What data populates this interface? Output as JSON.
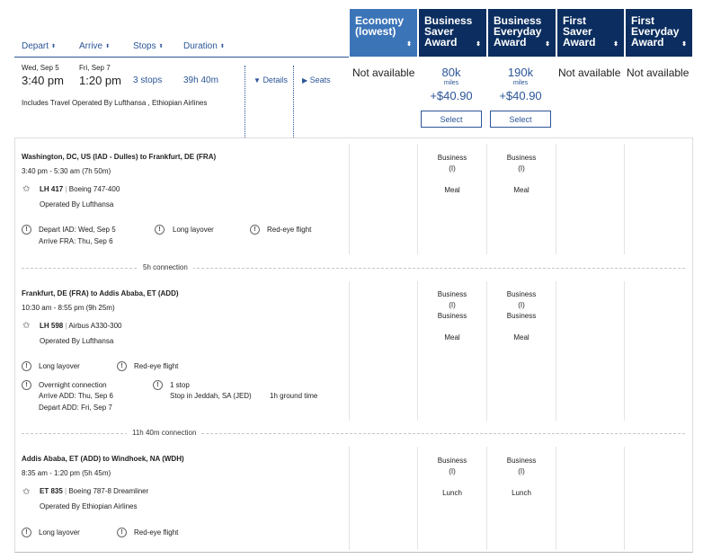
{
  "sort": {
    "depart": "Depart",
    "arrive": "Arrive",
    "stops": "Stops",
    "duration": "Duration",
    "arrow": "⬍"
  },
  "fares": [
    {
      "title": "Economy",
      "sub": "(lowest)"
    },
    {
      "title": "Business Saver Award"
    },
    {
      "title": "Business Everyday Award"
    },
    {
      "title": "First Saver Award"
    },
    {
      "title": "First Everyday Award"
    }
  ],
  "summary": {
    "depart_date": "Wed, Sep 5",
    "depart_time": "3:40 pm",
    "arrive_date": "Fri, Sep 7",
    "arrive_time": "1:20 pm",
    "stops": "3 stops",
    "duration": "39h 40m",
    "details": "Details",
    "seats": "Seats",
    "operated_note": "Includes Travel Operated By Lufthansa , Ethiopian Airlines"
  },
  "prices": {
    "economy": "Not available",
    "business_saver": {
      "miles": "80k",
      "miles_label": "miles",
      "taxes": "+$40.90",
      "select": "Select"
    },
    "business_everyday": {
      "miles": "190k",
      "miles_label": "miles",
      "taxes": "+$40.90",
      "select": "Select"
    },
    "first_saver": "Not available",
    "first_everyday": "Not available"
  },
  "segments": [
    {
      "route": "Washington, DC, US (IAD - Dulles) to Frankfurt, DE (FRA)",
      "times": "3:40 pm - 5:30 am (7h 50m)",
      "flight": "LH 417",
      "aircraft": "Boeing 747-400",
      "operated": "Operated By Lufthansa",
      "notes": {
        "depart": "Depart IAD: Wed, Sep 5",
        "arrive": "Arrive FRA: Thu, Sep 6",
        "layover": "Long layover",
        "redeye": "Red-eye flight"
      },
      "cabins": {
        "saver": [
          "Business",
          "(I)",
          "",
          "Meal"
        ],
        "everyday": [
          "Business",
          "(I)",
          "",
          "Meal"
        ]
      }
    },
    {
      "route": "Frankfurt, DE (FRA) to Addis Ababa, ET (ADD)",
      "times": "10:30 am - 8:55 pm (9h 25m)",
      "flight": "LH 598",
      "aircraft": "Airbus A330-300",
      "operated": "Operated By Lufthansa",
      "notes": {
        "layover": "Long layover",
        "redeye": "Red-eye flight",
        "overnight": "Overnight connection",
        "arrive": "Arrive ADD: Thu, Sep 6",
        "depart": "Depart ADD: Fri, Sep 7",
        "stop": "1 stop",
        "stop_at": "Stop in Jeddah, SA (JED)",
        "ground": "1h ground time"
      },
      "cabins": {
        "saver": [
          "Business",
          "(I)",
          "Business",
          "",
          "Meal"
        ],
        "everyday": [
          "Business",
          "(I)",
          "Business",
          "",
          "Meal"
        ]
      }
    },
    {
      "route": "Addis Ababa, ET (ADD) to Windhoek, NA (WDH)",
      "times": "8:35 am - 1:20 pm (5h 45m)",
      "flight": "ET 835",
      "aircraft": "Boeing 787-8 Dreamliner",
      "operated": "Operated By Ethiopian Airlines",
      "notes": {
        "layover": "Long layover",
        "redeye": "Red-eye flight"
      },
      "cabins": {
        "saver": [
          "Business",
          "(I)",
          "",
          "Lunch"
        ],
        "everyday": [
          "Business",
          "(I)",
          "",
          "Lunch"
        ]
      }
    }
  ],
  "connections": [
    "5h connection",
    "11h 40m connection"
  ],
  "glyphs": {
    "warn": "!",
    "star": "✩",
    "sep": "|",
    "tri_down": "▼",
    "tri_right": "▶"
  }
}
